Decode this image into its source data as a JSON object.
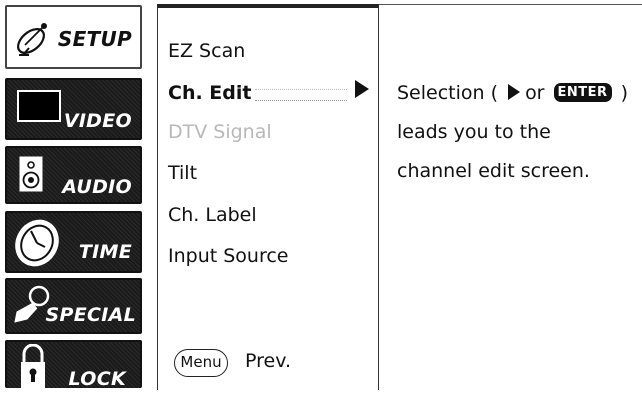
{
  "sidebar": {
    "tabs": [
      {
        "label": "SETUP",
        "icon": "satellite-dish-icon",
        "active": true
      },
      {
        "label": "VIDEO",
        "icon": "screen-icon",
        "active": false
      },
      {
        "label": "AUDIO",
        "icon": "speaker-icon",
        "active": false
      },
      {
        "label": "TIME",
        "icon": "clock-icon",
        "active": false
      },
      {
        "label": "SPECIAL",
        "icon": "magnifier-icon",
        "active": false
      },
      {
        "label": "LOCK",
        "icon": "padlock-icon",
        "active": false
      }
    ]
  },
  "menu": {
    "items": [
      {
        "label": "EZ Scan",
        "state": "normal"
      },
      {
        "label": "Ch. Edit",
        "state": "selected"
      },
      {
        "label": "DTV Signal",
        "state": "disabled"
      },
      {
        "label": "Tilt",
        "state": "normal"
      },
      {
        "label": "Ch. Label",
        "state": "normal"
      },
      {
        "label": "Input Source",
        "state": "normal"
      }
    ],
    "menu_button": "Menu",
    "prev_label": "Prev."
  },
  "help": {
    "line1_prefix": "Selection (",
    "line1_or": "or",
    "enter_badge": "ENTER",
    "line1_suffix": ")",
    "line2": "leads you to the",
    "line3": "channel edit screen."
  }
}
